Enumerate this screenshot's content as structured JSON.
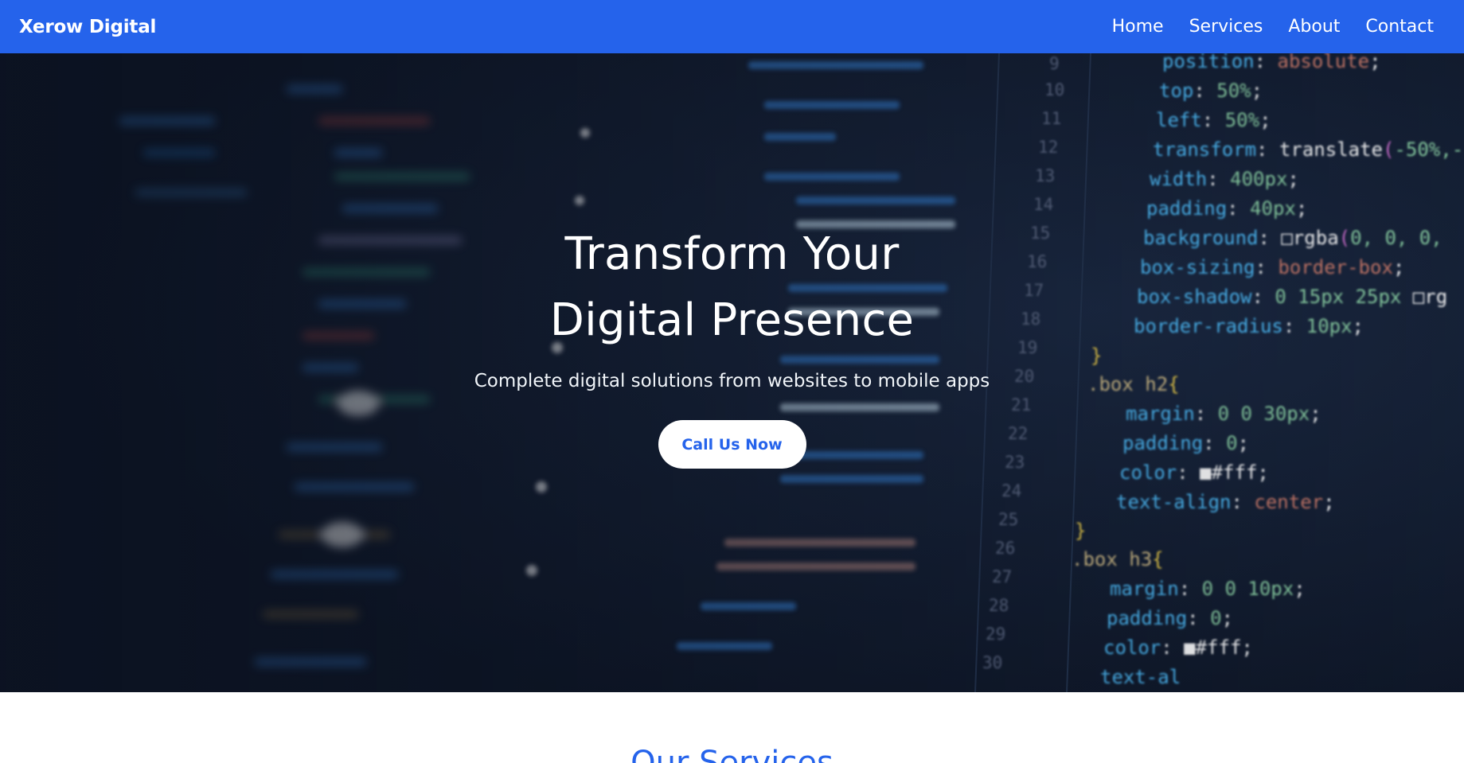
{
  "navbar": {
    "brand": "Xerow Digital",
    "links": [
      "Home",
      "Services",
      "About",
      "Contact"
    ],
    "background": "#2563eb"
  },
  "hero": {
    "title": "Transform Your Digital Presence",
    "subtitle": "Complete digital solutions from websites to mobile apps",
    "cta_label": "Call Us Now",
    "background_image": "code-editor-photo",
    "code_lines": {
      "line_numbers": [
        "9",
        "10",
        "11",
        "12",
        "13",
        "14",
        "15",
        "16",
        "17",
        "18",
        "19",
        "20",
        "21",
        "22",
        "23",
        "24",
        "25",
        "26",
        "27",
        "28",
        "29",
        "30"
      ],
      "lines": [
        "position: absolute;",
        "top: 50%;",
        "left: 50%;",
        "transform: translate(-50%,-",
        "width: 400px;",
        "padding: 40px;",
        "background: rgba(0, 0, 0,",
        "box-sizing: border-box;",
        "box-shadow: 0 15px 25px rg",
        "border-radius: 10px;",
        "}",
        ".box h2{",
        "margin: 0 0 30px;",
        "padding: 0;",
        "color: #fff;",
        "text-align: center;",
        "}",
        ".box h3{",
        "margin: 0 0 10px;",
        "padding: 0;",
        "color: #fff;",
        "text-al"
      ]
    }
  },
  "services": {
    "title": "Our Services"
  },
  "colors": {
    "accent": "#2563eb",
    "hero_dark": "#101a2e"
  }
}
